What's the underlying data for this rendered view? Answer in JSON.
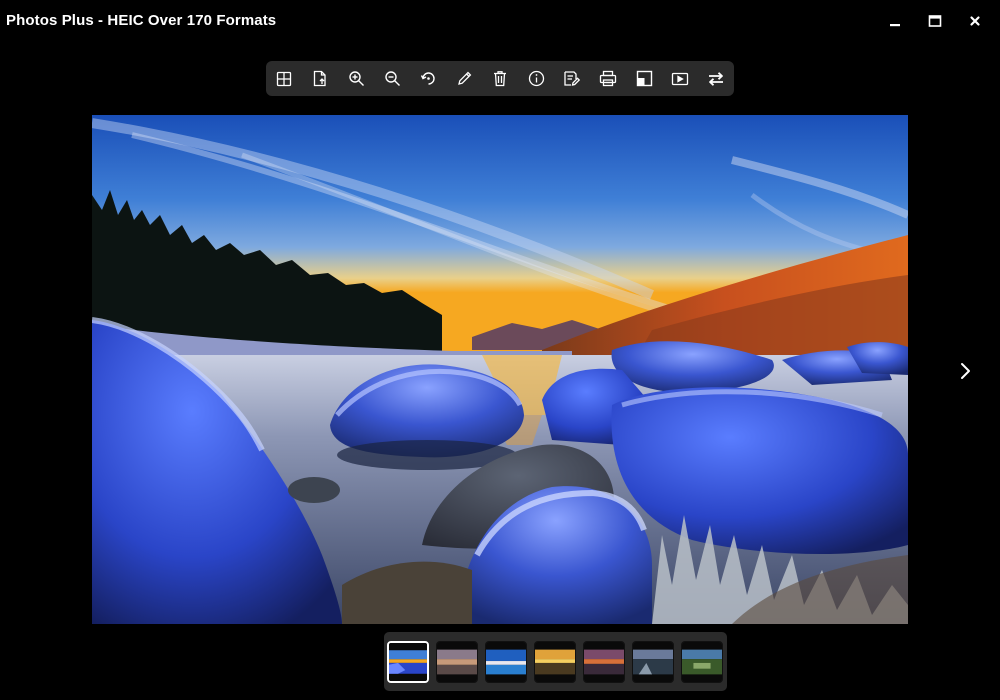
{
  "window": {
    "title": "Photos Plus - HEIC Over 170 Formats",
    "controls": [
      "minimize-icon",
      "maximize-icon",
      "close-icon"
    ]
  },
  "toolbar": {
    "tools": [
      {
        "id": "gallery",
        "icon": "grid-icon"
      },
      {
        "id": "open",
        "icon": "file-open-icon"
      },
      {
        "id": "zoom-in",
        "icon": "zoom-in-icon"
      },
      {
        "id": "zoom-out",
        "icon": "zoom-out-icon"
      },
      {
        "id": "rotate",
        "icon": "rotate-icon"
      },
      {
        "id": "edit",
        "icon": "pencil-icon"
      },
      {
        "id": "delete",
        "icon": "trash-icon"
      },
      {
        "id": "info",
        "icon": "info-icon"
      },
      {
        "id": "save-as",
        "icon": "save-edit-icon"
      },
      {
        "id": "print",
        "icon": "printer-icon"
      },
      {
        "id": "set-background",
        "icon": "wallpaper-icon"
      },
      {
        "id": "slideshow",
        "icon": "slideshow-icon"
      },
      {
        "id": "convert",
        "icon": "convert-arrows-icon"
      }
    ]
  },
  "viewer": {
    "next_icon": "chevron-right-icon"
  },
  "thumbnails": {
    "selected_index": 0,
    "count": 7
  },
  "colors": {
    "background": "#000000",
    "toolbar_bg": "#2b2b2b",
    "icon": "#ffffff",
    "selected_border": "#ffffff"
  }
}
